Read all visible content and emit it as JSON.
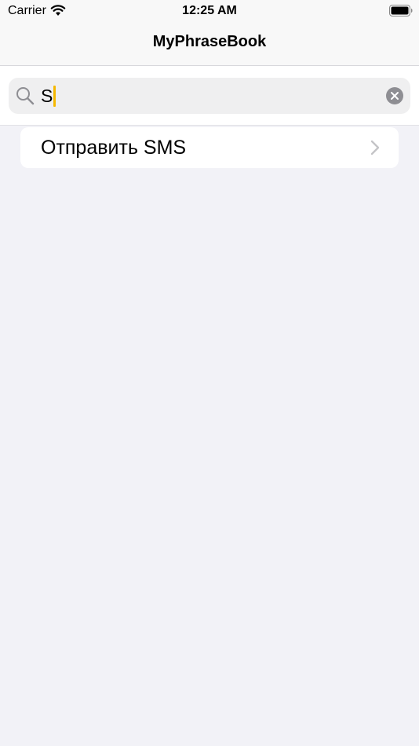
{
  "status_bar": {
    "carrier": "Carrier",
    "time": "12:25 AM",
    "icons": [
      "wifi-icon",
      "battery-icon"
    ]
  },
  "nav_bar": {
    "title": "MyPhraseBook"
  },
  "search": {
    "value": "S",
    "icons": [
      "search-icon",
      "clear-icon"
    ]
  },
  "results": [
    {
      "label": "Отправить SMS",
      "accessory": "chevron-right-icon"
    }
  ],
  "colors": {
    "background": "#f2f2f7",
    "bar_background": "#f8f8f8",
    "search_field": "#efeff0",
    "caret": "#f5b800",
    "chevron": "#c4c4c7",
    "clear_button": "#8e8e93"
  }
}
